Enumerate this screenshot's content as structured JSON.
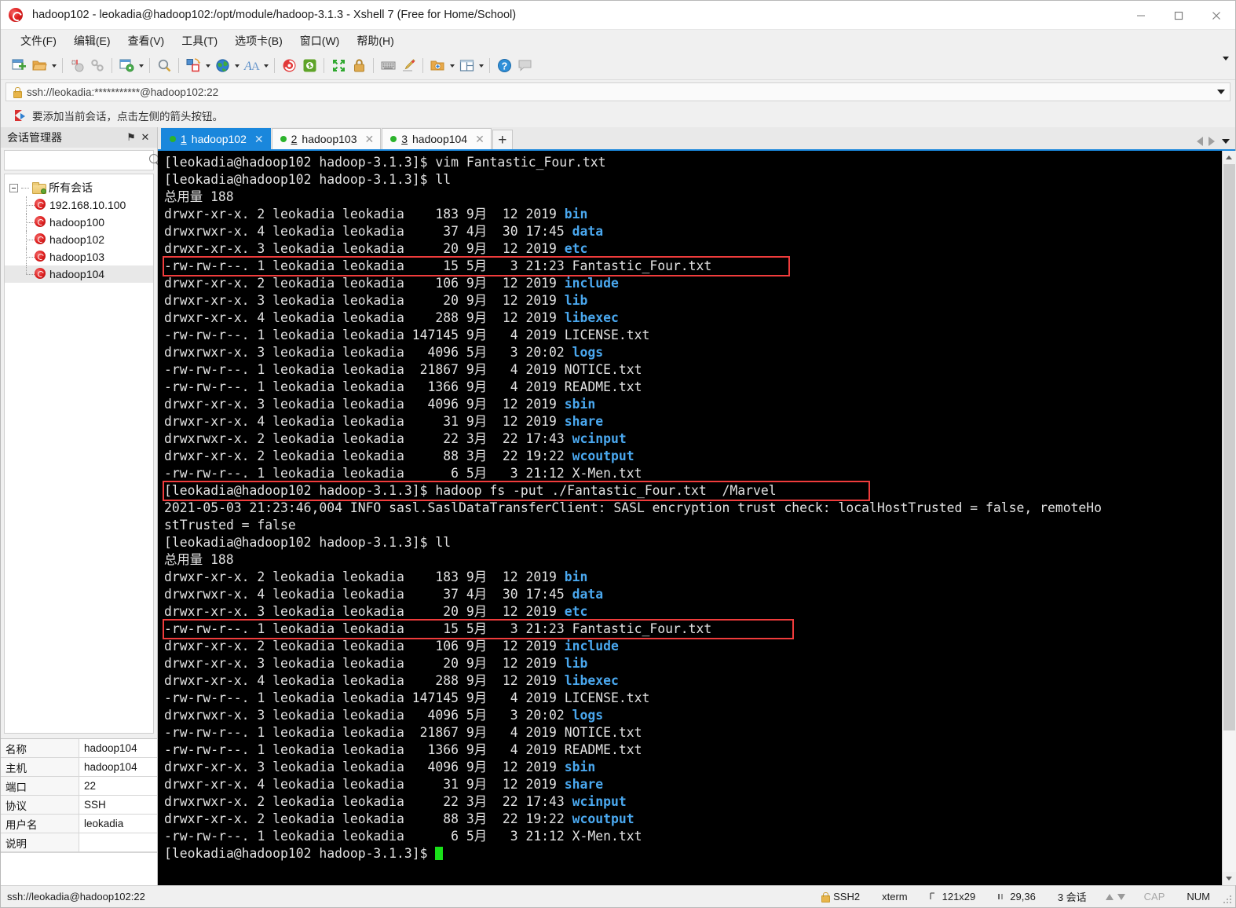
{
  "window": {
    "title": "hadoop102 - leokadia@hadoop102:/opt/module/hadoop-3.1.3 - Xshell 7 (Free for Home/School)",
    "minimize_label": "─",
    "maximize_label": "□",
    "close_label": "✕"
  },
  "menubar": {
    "items": [
      {
        "label": "文件(F)"
      },
      {
        "label": "编辑(E)"
      },
      {
        "label": "查看(V)"
      },
      {
        "label": "工具(T)"
      },
      {
        "label": "选项卡(B)"
      },
      {
        "label": "窗口(W)"
      },
      {
        "label": "帮助(H)"
      }
    ]
  },
  "addressbar": {
    "value": "ssh://leokadia:***********@hadoop102:22"
  },
  "notice": {
    "text": "要添加当前会话，点击左侧的箭头按钮。"
  },
  "sidebar": {
    "title": "会话管理器",
    "pin_label": "⚑",
    "close_label": "✕",
    "search_placeholder": "",
    "search_value": "",
    "tree": {
      "root_label": "所有会话",
      "nodes": [
        {
          "label": "192.168.10.100",
          "selected": false
        },
        {
          "label": "hadoop100",
          "selected": false
        },
        {
          "label": "hadoop102",
          "selected": false
        },
        {
          "label": "hadoop103",
          "selected": false
        },
        {
          "label": "hadoop104",
          "selected": true
        }
      ]
    },
    "properties": [
      {
        "key": "名称",
        "value": "hadoop104"
      },
      {
        "key": "主机",
        "value": "hadoop104"
      },
      {
        "key": "端口",
        "value": "22"
      },
      {
        "key": "协议",
        "value": "SSH"
      },
      {
        "key": "用户名",
        "value": "leokadia"
      },
      {
        "key": "说明",
        "value": ""
      }
    ]
  },
  "toolbar": {
    "buttons": [
      {
        "name": "new-session-icon",
        "caret": false
      },
      {
        "name": "open-folder-icon",
        "caret": true
      },
      {
        "name": "sep",
        "caret": false
      },
      {
        "name": "disconnect-icon",
        "caret": false
      },
      {
        "name": "reconnect-icon",
        "caret": false
      },
      {
        "name": "sep",
        "caret": false
      },
      {
        "name": "session-properties-icon",
        "caret": true
      },
      {
        "name": "sep",
        "caret": false
      },
      {
        "name": "find-icon",
        "caret": false
      },
      {
        "name": "sep",
        "caret": false
      },
      {
        "name": "transfer-icon",
        "caret": true
      },
      {
        "name": "globe-icon",
        "caret": true
      },
      {
        "name": "font-icon",
        "caret": true
      },
      {
        "name": "sep",
        "caret": false
      },
      {
        "name": "xshell-icon",
        "caret": false
      },
      {
        "name": "xftp-icon",
        "caret": false
      },
      {
        "name": "sep",
        "caret": false
      },
      {
        "name": "fullscreen-icon",
        "caret": false
      },
      {
        "name": "lock-icon",
        "caret": false
      },
      {
        "name": "sep",
        "caret": false
      },
      {
        "name": "keyboard-icon",
        "caret": false
      },
      {
        "name": "highlight-icon",
        "caret": false
      },
      {
        "name": "sep",
        "caret": false
      },
      {
        "name": "add-folder-icon",
        "caret": true
      },
      {
        "name": "layout-icon",
        "caret": true
      },
      {
        "name": "sep",
        "caret": false
      },
      {
        "name": "help-icon",
        "caret": false
      },
      {
        "name": "chat-icon",
        "caret": false
      }
    ]
  },
  "tabs": {
    "items": [
      {
        "num": "1",
        "label": "hadoop102",
        "active": true,
        "close": "✕"
      },
      {
        "num": "2",
        "label": "hadoop103",
        "active": false,
        "close": "✕"
      },
      {
        "num": "3",
        "label": "hadoop104",
        "active": false,
        "close": "✕"
      }
    ],
    "add_label": "+"
  },
  "terminal": {
    "prompt": "[leokadia@hadoop102 hadoop-3.1.3]$ ",
    "lines": [
      {
        "text": "[leokadia@hadoop102 hadoop-3.1.3]$ vim Fantastic_Four.txt"
      },
      {
        "text": "[leokadia@hadoop102 hadoop-3.1.3]$ ll"
      },
      {
        "text": "总用量 188",
        "cjk": true
      },
      {
        "pre": "drwxr-xr-x. 2 leokadia leokadia    183 9月  12 2019 ",
        "blue": "bin"
      },
      {
        "pre": "drwxrwxr-x. 4 leokadia leokadia     37 4月  30 17:45 ",
        "blue": "data"
      },
      {
        "pre": "drwxr-xr-x. 3 leokadia leokadia     20 9月  12 2019 ",
        "blue": "etc"
      },
      {
        "text": "-rw-rw-r--. 1 leokadia leokadia     15 5月   3 21:23 Fantastic_Four.txt",
        "hl": true
      },
      {
        "pre": "drwxr-xr-x. 2 leokadia leokadia    106 9月  12 2019 ",
        "blue": "include"
      },
      {
        "pre": "drwxr-xr-x. 3 leokadia leokadia     20 9月  12 2019 ",
        "blue": "lib"
      },
      {
        "pre": "drwxr-xr-x. 4 leokadia leokadia    288 9月  12 2019 ",
        "blue": "libexec"
      },
      {
        "text": "-rw-rw-r--. 1 leokadia leokadia 147145 9月   4 2019 LICENSE.txt"
      },
      {
        "pre": "drwxrwxr-x. 3 leokadia leokadia   4096 5月   3 20:02 ",
        "blue": "logs"
      },
      {
        "text": "-rw-rw-r--. 1 leokadia leokadia  21867 9月   4 2019 NOTICE.txt"
      },
      {
        "text": "-rw-rw-r--. 1 leokadia leokadia   1366 9月   4 2019 README.txt"
      },
      {
        "pre": "drwxr-xr-x. 3 leokadia leokadia   4096 9月  12 2019 ",
        "blue": "sbin"
      },
      {
        "pre": "drwxr-xr-x. 4 leokadia leokadia     31 9月  12 2019 ",
        "blue": "share"
      },
      {
        "pre": "drwxrwxr-x. 2 leokadia leokadia     22 3月  22 17:43 ",
        "blue": "wcinput"
      },
      {
        "pre": "drwxr-xr-x. 2 leokadia leokadia     88 3月  22 19:22 ",
        "blue": "wcoutput"
      },
      {
        "text": "-rw-rw-r--. 1 leokadia leokadia      6 5月   3 21:12 X-Men.txt"
      },
      {
        "text": "[leokadia@hadoop102 hadoop-3.1.3]$ hadoop fs -put ./Fantastic_Four.txt  /Marvel",
        "hl": true,
        "wide": "w2"
      },
      {
        "text": "2021-05-03 21:23:46,004 INFO sasl.SaslDataTransferClient: SASL encryption trust check: localHostTrusted = false, remoteHo"
      },
      {
        "text": "stTrusted = false"
      },
      {
        "text": "[leokadia@hadoop102 hadoop-3.1.3]$ ll"
      },
      {
        "text": "总用量 188",
        "cjk": true
      },
      {
        "pre": "drwxr-xr-x. 2 leokadia leokadia    183 9月  12 2019 ",
        "blue": "bin"
      },
      {
        "pre": "drwxrwxr-x. 4 leokadia leokadia     37 4月  30 17:45 ",
        "blue": "data"
      },
      {
        "pre": "drwxr-xr-x. 3 leokadia leokadia     20 9月  12 2019 ",
        "blue": "etc"
      },
      {
        "text": "-rw-rw-r--. 1 leokadia leokadia     15 5月   3 21:23 Fantastic_Four.txt",
        "hl": true,
        "wide": "w3"
      },
      {
        "pre": "drwxr-xr-x. 2 leokadia leokadia    106 9月  12 2019 ",
        "blue": "include"
      },
      {
        "pre": "drwxr-xr-x. 3 leokadia leokadia     20 9月  12 2019 ",
        "blue": "lib"
      },
      {
        "pre": "drwxr-xr-x. 4 leokadia leokadia    288 9月  12 2019 ",
        "blue": "libexec"
      },
      {
        "text": "-rw-rw-r--. 1 leokadia leokadia 147145 9月   4 2019 LICENSE.txt"
      },
      {
        "pre": "drwxrwxr-x. 3 leokadia leokadia   4096 5月   3 20:02 ",
        "blue": "logs"
      },
      {
        "text": "-rw-rw-r--. 1 leokadia leokadia  21867 9月   4 2019 NOTICE.txt"
      },
      {
        "text": "-rw-rw-r--. 1 leokadia leokadia   1366 9月   4 2019 README.txt"
      },
      {
        "pre": "drwxr-xr-x. 3 leokadia leokadia   4096 9月  12 2019 ",
        "blue": "sbin"
      },
      {
        "pre": "drwxr-xr-x. 4 leokadia leokadia     31 9月  12 2019 ",
        "blue": "share"
      },
      {
        "pre": "drwxrwxr-x. 2 leokadia leokadia     22 3月  22 17:43 ",
        "blue": "wcinput"
      },
      {
        "pre": "drwxr-xr-x. 2 leokadia leokadia     88 3月  22 19:22 ",
        "blue": "wcoutput"
      },
      {
        "text": "-rw-rw-r--. 1 leokadia leokadia      6 5月   3 21:12 X-Men.txt"
      },
      {
        "text": "[leokadia@hadoop102 hadoop-3.1.3]$ ",
        "cursor": true
      }
    ]
  },
  "statusbar": {
    "left": "ssh://leokadia@hadoop102:22",
    "protocol": "SSH2",
    "terminal_type": "xterm",
    "size": "121x29",
    "cursor_pos": "29,36",
    "sessions": "3 会话",
    "cap": "CAP",
    "num": "NUM"
  },
  "colors": {
    "accent": "#1a87dc",
    "terminal_bg": "#000000",
    "terminal_fg": "#e2e2e2",
    "dir_blue": "#4aa8ef",
    "highlight_red": "#f03c3c",
    "cursor_green": "#19e019"
  }
}
